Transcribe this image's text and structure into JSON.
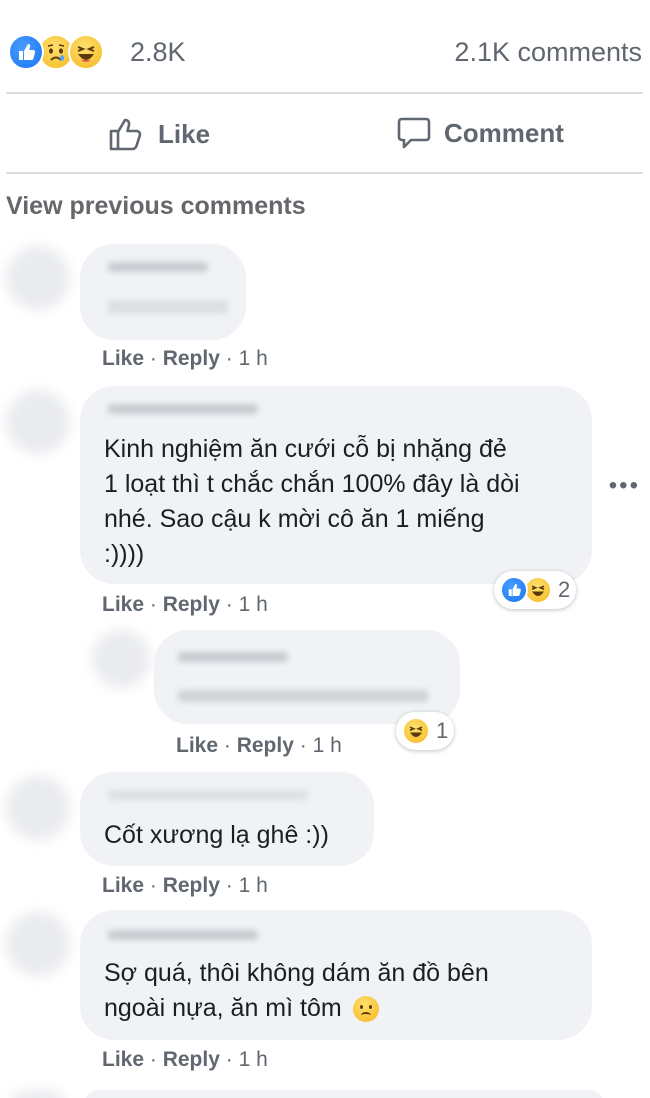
{
  "reactions": {
    "types": [
      "like-icon",
      "sad-icon",
      "haha-icon"
    ],
    "count": "2.8K",
    "comments": "2.1K comments"
  },
  "actions": {
    "like_label": "Like",
    "comment_label": "Comment"
  },
  "view_previous": "View previous comments",
  "meta_labels": {
    "like": "Like",
    "reply": "Reply",
    "sep": " · "
  },
  "comments": [
    {
      "text": "",
      "time": "1 h"
    },
    {
      "text_lines": [
        "Kinh nghiệm ăn cưới cỗ bị nhặng đẻ",
        "1 loạt thì t chắc chắn 100% đây là dòi",
        "nhé. Sao cậu k mời cô ăn 1 miếng",
        ":))))"
      ],
      "time": "1 h",
      "reaction_count": "2"
    },
    {
      "text": "",
      "time": "1 h",
      "reaction_count": "1"
    },
    {
      "text": "Cốt xương lạ ghê :))",
      "time": "1 h"
    },
    {
      "text_lines": [
        "Sợ quá, thôi không dám ăn đồ bên",
        "ngoài nựa, ăn mì tôm"
      ],
      "time": "1 h"
    }
  ],
  "colors": {
    "like_blue": "#1877f2",
    "emoji_yellow": "#f5b81d",
    "bubble_bg": "#f0f2f5",
    "meta_gray": "#606770"
  }
}
